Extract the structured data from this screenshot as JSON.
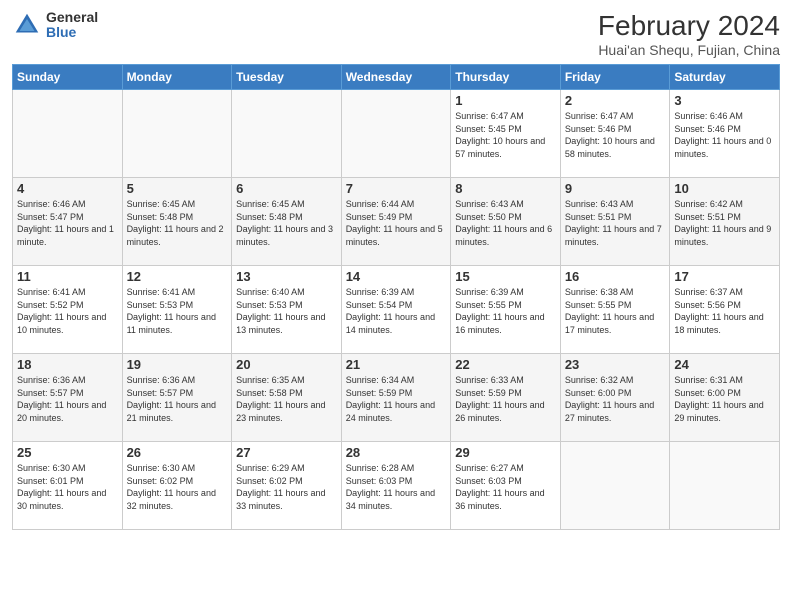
{
  "logo": {
    "general": "General",
    "blue": "Blue"
  },
  "title": {
    "main": "February 2024",
    "sub": "Huai'an Shequ, Fujian, China"
  },
  "headers": [
    "Sunday",
    "Monday",
    "Tuesday",
    "Wednesday",
    "Thursday",
    "Friday",
    "Saturday"
  ],
  "weeks": [
    [
      {
        "day": "",
        "info": ""
      },
      {
        "day": "",
        "info": ""
      },
      {
        "day": "",
        "info": ""
      },
      {
        "day": "",
        "info": ""
      },
      {
        "day": "1",
        "info": "Sunrise: 6:47 AM\nSunset: 5:45 PM\nDaylight: 10 hours and 57 minutes."
      },
      {
        "day": "2",
        "info": "Sunrise: 6:47 AM\nSunset: 5:46 PM\nDaylight: 10 hours and 58 minutes."
      },
      {
        "day": "3",
        "info": "Sunrise: 6:46 AM\nSunset: 5:46 PM\nDaylight: 11 hours and 0 minutes."
      }
    ],
    [
      {
        "day": "4",
        "info": "Sunrise: 6:46 AM\nSunset: 5:47 PM\nDaylight: 11 hours and 1 minute."
      },
      {
        "day": "5",
        "info": "Sunrise: 6:45 AM\nSunset: 5:48 PM\nDaylight: 11 hours and 2 minutes."
      },
      {
        "day": "6",
        "info": "Sunrise: 6:45 AM\nSunset: 5:48 PM\nDaylight: 11 hours and 3 minutes."
      },
      {
        "day": "7",
        "info": "Sunrise: 6:44 AM\nSunset: 5:49 PM\nDaylight: 11 hours and 5 minutes."
      },
      {
        "day": "8",
        "info": "Sunrise: 6:43 AM\nSunset: 5:50 PM\nDaylight: 11 hours and 6 minutes."
      },
      {
        "day": "9",
        "info": "Sunrise: 6:43 AM\nSunset: 5:51 PM\nDaylight: 11 hours and 7 minutes."
      },
      {
        "day": "10",
        "info": "Sunrise: 6:42 AM\nSunset: 5:51 PM\nDaylight: 11 hours and 9 minutes."
      }
    ],
    [
      {
        "day": "11",
        "info": "Sunrise: 6:41 AM\nSunset: 5:52 PM\nDaylight: 11 hours and 10 minutes."
      },
      {
        "day": "12",
        "info": "Sunrise: 6:41 AM\nSunset: 5:53 PM\nDaylight: 11 hours and 11 minutes."
      },
      {
        "day": "13",
        "info": "Sunrise: 6:40 AM\nSunset: 5:53 PM\nDaylight: 11 hours and 13 minutes."
      },
      {
        "day": "14",
        "info": "Sunrise: 6:39 AM\nSunset: 5:54 PM\nDaylight: 11 hours and 14 minutes."
      },
      {
        "day": "15",
        "info": "Sunrise: 6:39 AM\nSunset: 5:55 PM\nDaylight: 11 hours and 16 minutes."
      },
      {
        "day": "16",
        "info": "Sunrise: 6:38 AM\nSunset: 5:55 PM\nDaylight: 11 hours and 17 minutes."
      },
      {
        "day": "17",
        "info": "Sunrise: 6:37 AM\nSunset: 5:56 PM\nDaylight: 11 hours and 18 minutes."
      }
    ],
    [
      {
        "day": "18",
        "info": "Sunrise: 6:36 AM\nSunset: 5:57 PM\nDaylight: 11 hours and 20 minutes."
      },
      {
        "day": "19",
        "info": "Sunrise: 6:36 AM\nSunset: 5:57 PM\nDaylight: 11 hours and 21 minutes."
      },
      {
        "day": "20",
        "info": "Sunrise: 6:35 AM\nSunset: 5:58 PM\nDaylight: 11 hours and 23 minutes."
      },
      {
        "day": "21",
        "info": "Sunrise: 6:34 AM\nSunset: 5:59 PM\nDaylight: 11 hours and 24 minutes."
      },
      {
        "day": "22",
        "info": "Sunrise: 6:33 AM\nSunset: 5:59 PM\nDaylight: 11 hours and 26 minutes."
      },
      {
        "day": "23",
        "info": "Sunrise: 6:32 AM\nSunset: 6:00 PM\nDaylight: 11 hours and 27 minutes."
      },
      {
        "day": "24",
        "info": "Sunrise: 6:31 AM\nSunset: 6:00 PM\nDaylight: 11 hours and 29 minutes."
      }
    ],
    [
      {
        "day": "25",
        "info": "Sunrise: 6:30 AM\nSunset: 6:01 PM\nDaylight: 11 hours and 30 minutes."
      },
      {
        "day": "26",
        "info": "Sunrise: 6:30 AM\nSunset: 6:02 PM\nDaylight: 11 hours and 32 minutes."
      },
      {
        "day": "27",
        "info": "Sunrise: 6:29 AM\nSunset: 6:02 PM\nDaylight: 11 hours and 33 minutes."
      },
      {
        "day": "28",
        "info": "Sunrise: 6:28 AM\nSunset: 6:03 PM\nDaylight: 11 hours and 34 minutes."
      },
      {
        "day": "29",
        "info": "Sunrise: 6:27 AM\nSunset: 6:03 PM\nDaylight: 11 hours and 36 minutes."
      },
      {
        "day": "",
        "info": ""
      },
      {
        "day": "",
        "info": ""
      }
    ]
  ]
}
